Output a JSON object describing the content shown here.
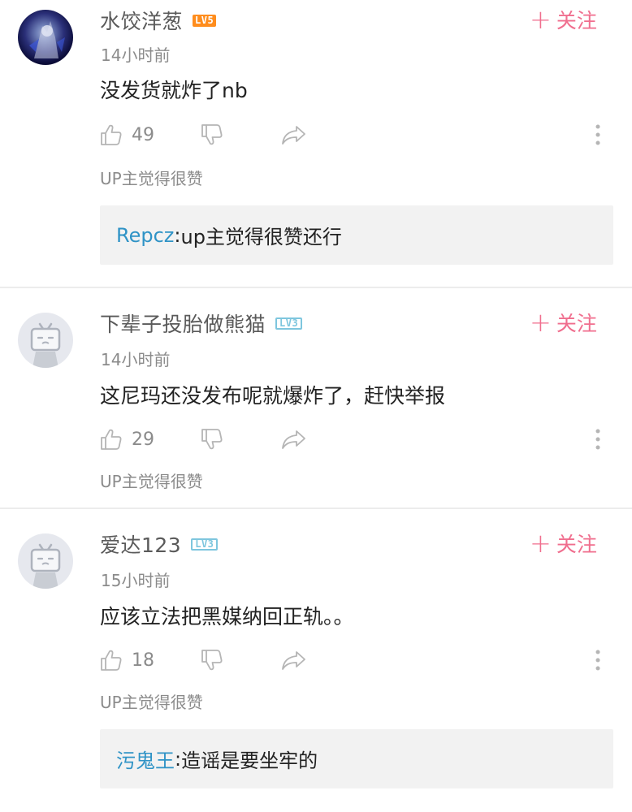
{
  "follow_label": "关注",
  "up_liked_label": "UP主觉得很赞",
  "comments": [
    {
      "username": "水饺洋葱",
      "level": "LV5",
      "time": "14小时前",
      "content": "没发货就炸了nb",
      "likes": "49",
      "reply": {
        "user": "Repcz",
        "text": "up主觉得很赞还行"
      }
    },
    {
      "username": "下辈子投胎做熊猫",
      "level": "LV3",
      "time": "14小时前",
      "content": "这尼玛还没发布呢就爆炸了，赶快举报",
      "likes": "29"
    },
    {
      "username": "爱达123",
      "level": "LV3",
      "time": "15小时前",
      "content": "应该立法把黑媒纳回正轨。。",
      "likes": "18",
      "reply": {
        "user": "污鬼王",
        "text": "造谣是要坐牢的"
      }
    }
  ],
  "colors": {
    "accent_pink": "#f06e8e",
    "level5": "#ff8d1d",
    "level3": "#7ec6de",
    "reply_user": "#2f93c6"
  }
}
